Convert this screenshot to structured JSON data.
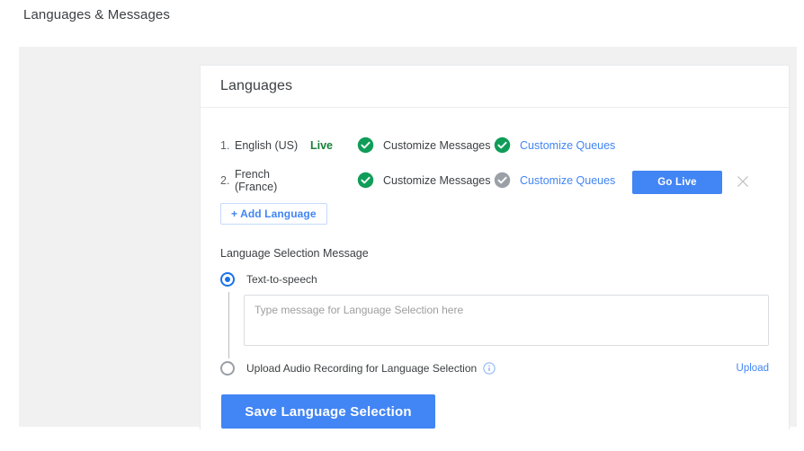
{
  "topbar": {
    "title": "Languages & Messages"
  },
  "card": {
    "title": "Languages",
    "languages": [
      {
        "index": "1.",
        "name": "English (US)",
        "status": "Live",
        "messages_label": "Customize Messages",
        "messages_icon": "check-circle-green-icon",
        "queues_label": "Customize Queues",
        "queues_icon": "check-circle-green-icon",
        "go_live_label": "",
        "has_go_live": false,
        "has_close": false
      },
      {
        "index": "2.",
        "name": "French (France)",
        "status": "",
        "messages_label": "Customize Messages",
        "messages_icon": "check-circle-green-icon",
        "queues_label": "Customize Queues",
        "queues_icon": "check-circle-gray-icon",
        "go_live_label": "Go Live",
        "has_go_live": true,
        "has_close": true
      }
    ],
    "add_language_label": "+ Add Language",
    "selection_message": {
      "section_label": "Language Selection Message",
      "tts_option_label": "Text-to-speech",
      "tts_selected": true,
      "textarea_value": "",
      "textarea_placeholder": "Type message for Language Selection here",
      "upload_option_label": "Upload Audio Recording for Language Selection",
      "upload_selected": false,
      "info_icon": "info-circle-icon",
      "upload_link_label": "Upload"
    },
    "save_label": "Save Language Selection"
  },
  "colors": {
    "accent_blue": "#4285f4",
    "link_blue": "#4285f4",
    "live_green": "#188038",
    "check_green": "#0f9d58",
    "check_gray": "#9aa0a6",
    "workspace_gray": "#f1f1f1"
  }
}
